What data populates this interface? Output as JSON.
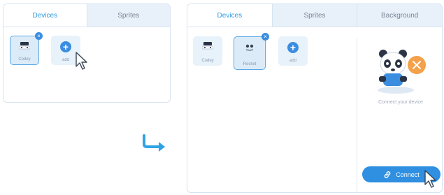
{
  "left_panel": {
    "tabs": [
      {
        "label": "Devices",
        "active": true
      },
      {
        "label": "Sprites",
        "active": false
      }
    ],
    "tiles": [
      {
        "label": "Codey",
        "selected": true,
        "icon": "codey-robot-icon"
      },
      {
        "label": "add",
        "selected": false,
        "icon": "plus-icon"
      }
    ]
  },
  "right_panel": {
    "tabs": [
      {
        "label": "Devices",
        "active": true
      },
      {
        "label": "Sprites",
        "active": false
      },
      {
        "label": "Background",
        "active": false
      }
    ],
    "tiles": [
      {
        "label": "Codey",
        "selected": false,
        "icon": "codey-robot-icon"
      },
      {
        "label": "Rocket",
        "selected": true,
        "icon": "rocket-robot-icon"
      },
      {
        "label": "add",
        "selected": false,
        "icon": "plus-icon"
      }
    ],
    "connect_caption": "Connect your device",
    "connect_button": "Connect"
  },
  "colors": {
    "accent": "#2f8fe0",
    "tab_inactive": "#e8f1fa",
    "border": "#d7e3f0"
  }
}
